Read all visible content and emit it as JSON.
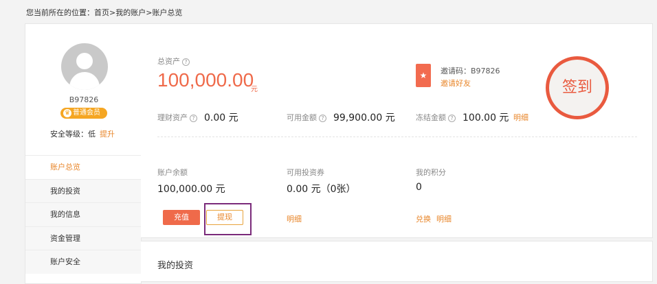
{
  "breadcrumb": {
    "prefix": "您当前所在的位置：",
    "home": "首页",
    "sep1": ">",
    "account": "我的账户",
    "sep2": ">",
    "current": "账户总览"
  },
  "profile": {
    "username": "B97826",
    "member_level": "普通会员",
    "security_label": "安全等级：低",
    "upgrade_link": "提升"
  },
  "nav": {
    "items": [
      {
        "label": "账户总览"
      },
      {
        "label": "我的投资"
      },
      {
        "label": "我的信息"
      },
      {
        "label": "资金管理"
      },
      {
        "label": "账户安全"
      }
    ]
  },
  "overview": {
    "total_assets_label": "总资产",
    "total_assets_value": "100,000.00",
    "total_assets_unit": "元",
    "invite_code": "邀请码：B97826",
    "invite_friend": "邀请好友",
    "sign_in": "签到",
    "finance_assets_label": "理财资产",
    "finance_assets_value": "0.00 元",
    "available_label": "可用金额",
    "available_value": "99,900.00 元",
    "frozen_label": "冻结金额",
    "frozen_value": "100.00 元",
    "detail_link": "明细",
    "balance_label": "账户余额",
    "balance_value": "100,000.00 元",
    "recharge_button": "充值",
    "withdraw_button": "提现",
    "coupons_label": "可用投资券",
    "coupons_value": "0.00 元（0张）",
    "coupons_detail": "明细",
    "points_label": "我的积分",
    "points_value": "0",
    "points_exchange": "兑换",
    "points_detail": "明细"
  },
  "investments": {
    "title": "我的投资"
  },
  "colors": {
    "accent_orange": "#e8862a",
    "amount_red": "#ef6a4a",
    "highlight_purple": "#7a2a7a"
  }
}
